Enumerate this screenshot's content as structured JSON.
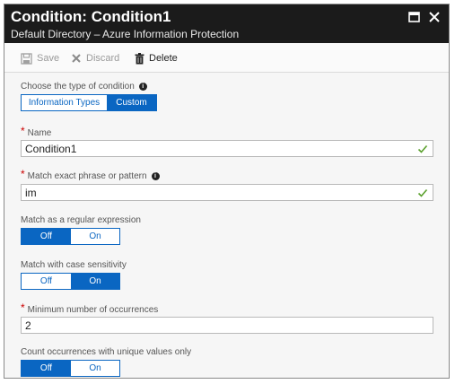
{
  "window": {
    "title": "Condition: Condition1",
    "subtitle": "Default Directory – Azure Information Protection",
    "maximize_icon": "maximize-icon",
    "close_icon": "close-icon"
  },
  "toolbar": {
    "save_label": "Save",
    "discard_label": "Discard",
    "delete_label": "Delete"
  },
  "condition_type": {
    "label": "Choose the type of condition",
    "options": [
      "Information Types",
      "Custom"
    ],
    "selected": "Custom"
  },
  "name": {
    "label": "Name",
    "value": "Condition1"
  },
  "match_phrase": {
    "label": "Match exact phrase or pattern",
    "value": "im"
  },
  "regex": {
    "label": "Match as a regular expression",
    "off_label": "Off",
    "on_label": "On",
    "selected": "Off"
  },
  "case_sensitivity": {
    "label": "Match with case sensitivity",
    "off_label": "Off",
    "on_label": "On",
    "selected": "On"
  },
  "min_occurrences": {
    "label": "Minimum number of occurrences",
    "value": "2"
  },
  "unique_values": {
    "label": "Count occurrences with unique values only",
    "off_label": "Off",
    "on_label": "On",
    "selected": "Off"
  },
  "colors": {
    "accent": "#0a66c2",
    "titlebar": "#1b1b1b",
    "valid_check": "#5aa02c",
    "required": "#cc0000"
  }
}
